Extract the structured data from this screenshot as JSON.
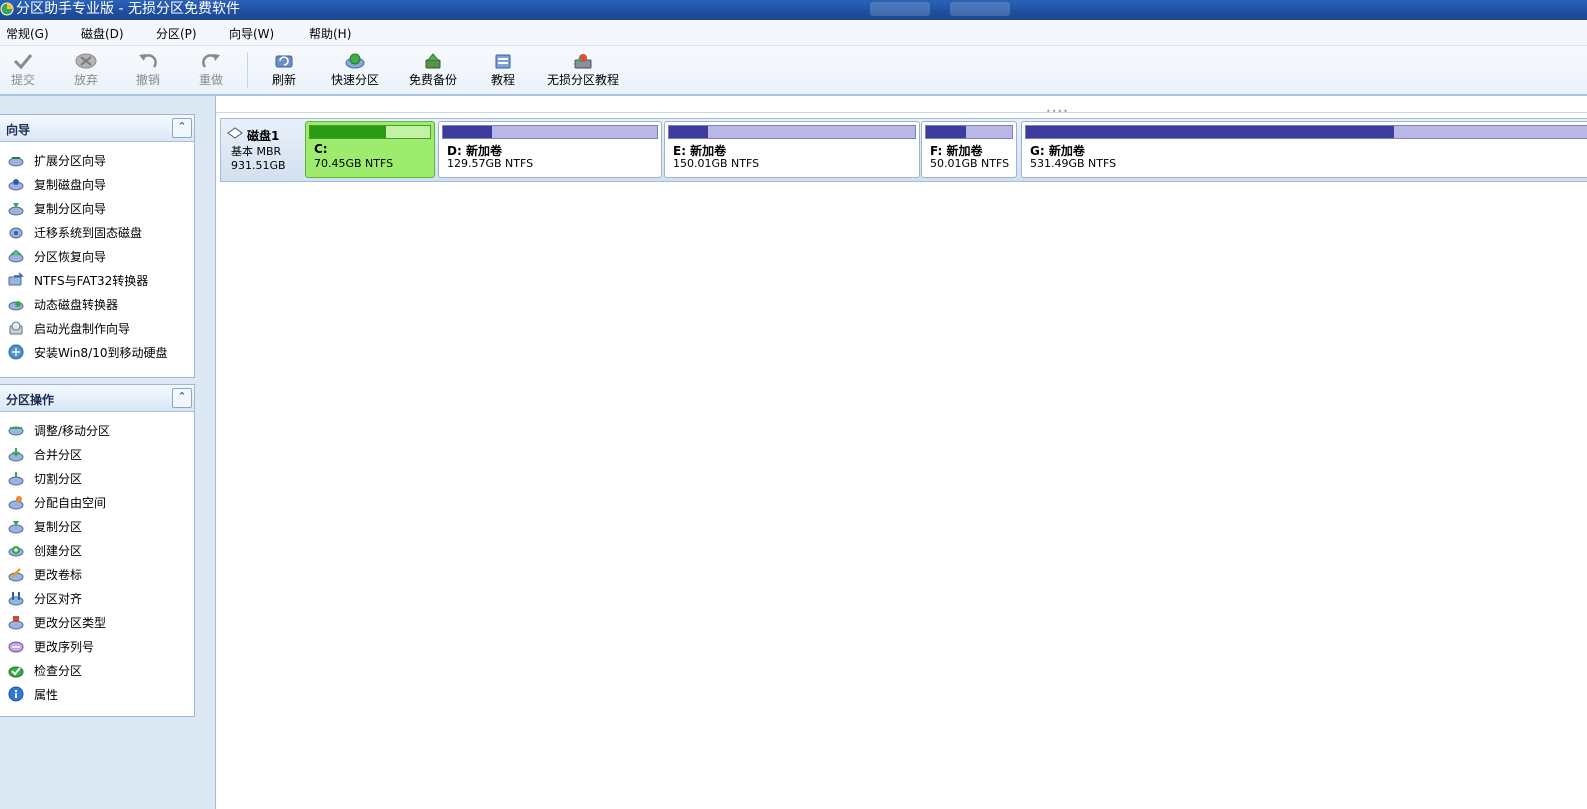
{
  "window": {
    "title": "分区助手专业版 - 无损分区免费软件"
  },
  "menu": [
    {
      "label": "常规(G)"
    },
    {
      "label": "磁盘(D)"
    },
    {
      "label": "分区(P)"
    },
    {
      "label": "向导(W)"
    },
    {
      "label": "帮助(H)"
    }
  ],
  "toolbar": {
    "commit": "提交",
    "discard": "放弃",
    "undo": "撤销",
    "redo": "重做",
    "refresh": "刷新",
    "quick_partition": "快速分区",
    "free_backup": "免费备份",
    "tutorial": "教程",
    "lossless_tutorial": "无损分区教程"
  },
  "wizard_panel": {
    "title": "向导",
    "items": [
      {
        "label": "扩展分区向导"
      },
      {
        "label": "复制磁盘向导"
      },
      {
        "label": "复制分区向导"
      },
      {
        "label": "迁移系统到固态磁盘"
      },
      {
        "label": "分区恢复向导"
      },
      {
        "label": "NTFS与FAT32转换器"
      },
      {
        "label": "动态磁盘转换器"
      },
      {
        "label": "启动光盘制作向导"
      },
      {
        "label": "安装Win8/10到移动硬盘"
      }
    ]
  },
  "ops_panel": {
    "title": "分区操作",
    "items": [
      {
        "label": "调整/移动分区"
      },
      {
        "label": "合并分区"
      },
      {
        "label": "切割分区"
      },
      {
        "label": "分配自由空间"
      },
      {
        "label": "复制分区"
      },
      {
        "label": "创建分区"
      },
      {
        "label": "更改卷标"
      },
      {
        "label": "分区对齐"
      },
      {
        "label": "更改分区类型"
      },
      {
        "label": "更改序列号"
      },
      {
        "label": "检查分区"
      },
      {
        "label": "属性"
      }
    ]
  },
  "disk": {
    "name": "磁盘1",
    "type": "基本 MBR",
    "size": "931.51GB",
    "partitions": [
      {
        "name": "C:",
        "info": "70.45GB NTFS",
        "used_fraction": 0.63,
        "selected": true
      },
      {
        "name": "D: 新加卷",
        "info": "129.57GB NTFS",
        "used_fraction": 0.23,
        "selected": false
      },
      {
        "name": "E: 新加卷",
        "info": "150.01GB NTFS",
        "used_fraction": 0.16,
        "selected": false
      },
      {
        "name": "F: 新加卷",
        "info": "50.01GB NTFS",
        "used_fraction": 0.46,
        "selected": false
      },
      {
        "name": "G: 新加卷",
        "info": "531.49GB NTFS",
        "used_fraction": 0.58,
        "selected": false
      }
    ]
  },
  "colors": {
    "titlebar": "#1f4f9e",
    "selected_partition": "#9eec6e",
    "used_space": "#3b3c9e",
    "free_space": "#b8b7e6"
  }
}
